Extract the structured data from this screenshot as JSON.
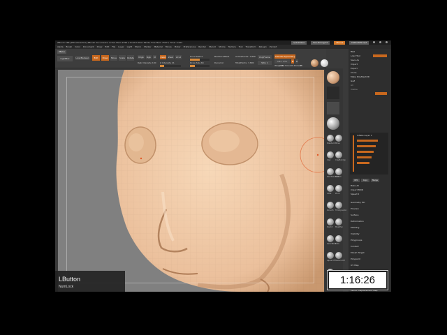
{
  "titlebar": {
    "title": "ZBrush 4R6  [ZBrushCentral]  ZBrush Document   ▸ Active Mem 2399 ▸ Scratch Disk 3944 ▸ Free Mem 7507 ▸ Timer 0.003",
    "quicksave": "QuickSave",
    "see_through": "See-through 0",
    "menus": "Menus",
    "default_script": "DefaultZScript"
  },
  "menubar": [
    "Alpha",
    "Brush",
    "Color",
    "Document",
    "Draw",
    "Edit",
    "File",
    "Layer",
    "Light",
    "Macro",
    "Marker",
    "Material",
    "Movie",
    "Picker",
    "Preferences",
    "Render",
    "Stencil",
    "Stroke",
    "Texture",
    "Tool",
    "Transform",
    "Zplugin",
    "Zscript"
  ],
  "shelf": {
    "menu_tab": "Menu",
    "lightbox": "LightBox",
    "live_boolean": "Live Boolean",
    "edit": "Edit",
    "draw": "Draw",
    "move": "Move",
    "scale": "Scale",
    "rotate": "Rotate",
    "mrgb": "Mrgb",
    "rgb": "Rgb",
    "m": "M",
    "zadd": "Zadd",
    "zsub": "Zsub",
    "zcut": "Zcut",
    "focal_shift": "Focal Shift 0",
    "draw_size": "Draw Size 64",
    "rgb_intensity": "Rgb Intensity 100",
    "z_intensity": "Z Intensity 21",
    "backface": "BackfaceMask",
    "dynamic": "Dynamic",
    "points": "ActivePoints: 7,890",
    "total_points": "TotalPoints: 7,890",
    "polyframe": "PolyFrame",
    "sdiv": "SDiv 1",
    "symmetry": "Activate Symmetry",
    "xyz": ">X< >Y< >Z<",
    "m_label": "M",
    "r_label": "R",
    "weighted_smooth": "Weighted Smooth Mode 0",
    "rs": "R5"
  },
  "tools": [
    {
      "name": "Standard"
    },
    {
      "name": "Move"
    },
    {
      "name": "Clay"
    },
    {
      "name": "ClayBuildup"
    },
    {
      "name": "DamStandard"
    },
    {
      "name": "hPolish"
    },
    {
      "name": "Inflat"
    },
    {
      "name": "Pinch"
    },
    {
      "name": "Smooth"
    },
    {
      "name": "TrimDynamic"
    },
    {
      "name": "Slash3"
    },
    {
      "name": "MaskPen"
    },
    {
      "name": "SelectRect"
    },
    {
      "name": "Dots"
    },
    {
      "name": "Alpha Off"
    },
    {
      "name": "Texture Off"
    },
    {
      "name": "SkinShade4"
    }
  ],
  "tray": {
    "rows_top": [
      "Load Tool",
      "Save As",
      "Import",
      "Export",
      "Clone",
      "Make PolyMesh3D",
      "GoZ",
      "All",
      "Visible"
    ],
    "subtool_items": [
      "Lightbox ▸ Tools",
      "PolyMesh3D_1",
      "SubTool",
      "Geometry",
      "Layers",
      "FiberMesh",
      "Geometry HD",
      "Preview",
      "Surface",
      "Deformation",
      "Masking",
      "Visibility",
      "Polygroups",
      "Contact",
      "Morph Target",
      "Polypaint",
      "UV Map",
      "Texture Map",
      "Displacement Map",
      "Normal Map",
      "Vector Displacement Map"
    ],
    "menu_header": "Tool",
    "layer_title": "Inflate Layer 1",
    "rec": "REC",
    "copy": "Copy",
    "merge": "Merge",
    "bake_all": "Bake All",
    "import_mdd": "Import MDD",
    "speed": "Speed 0"
  },
  "overlay": {
    "lbutton": "LButton",
    "numlock": "NumLock",
    "timer": "1:16:26"
  },
  "colors": {
    "accent": "#c8681e",
    "skin": "#f2c9a3",
    "background": "#808080"
  }
}
